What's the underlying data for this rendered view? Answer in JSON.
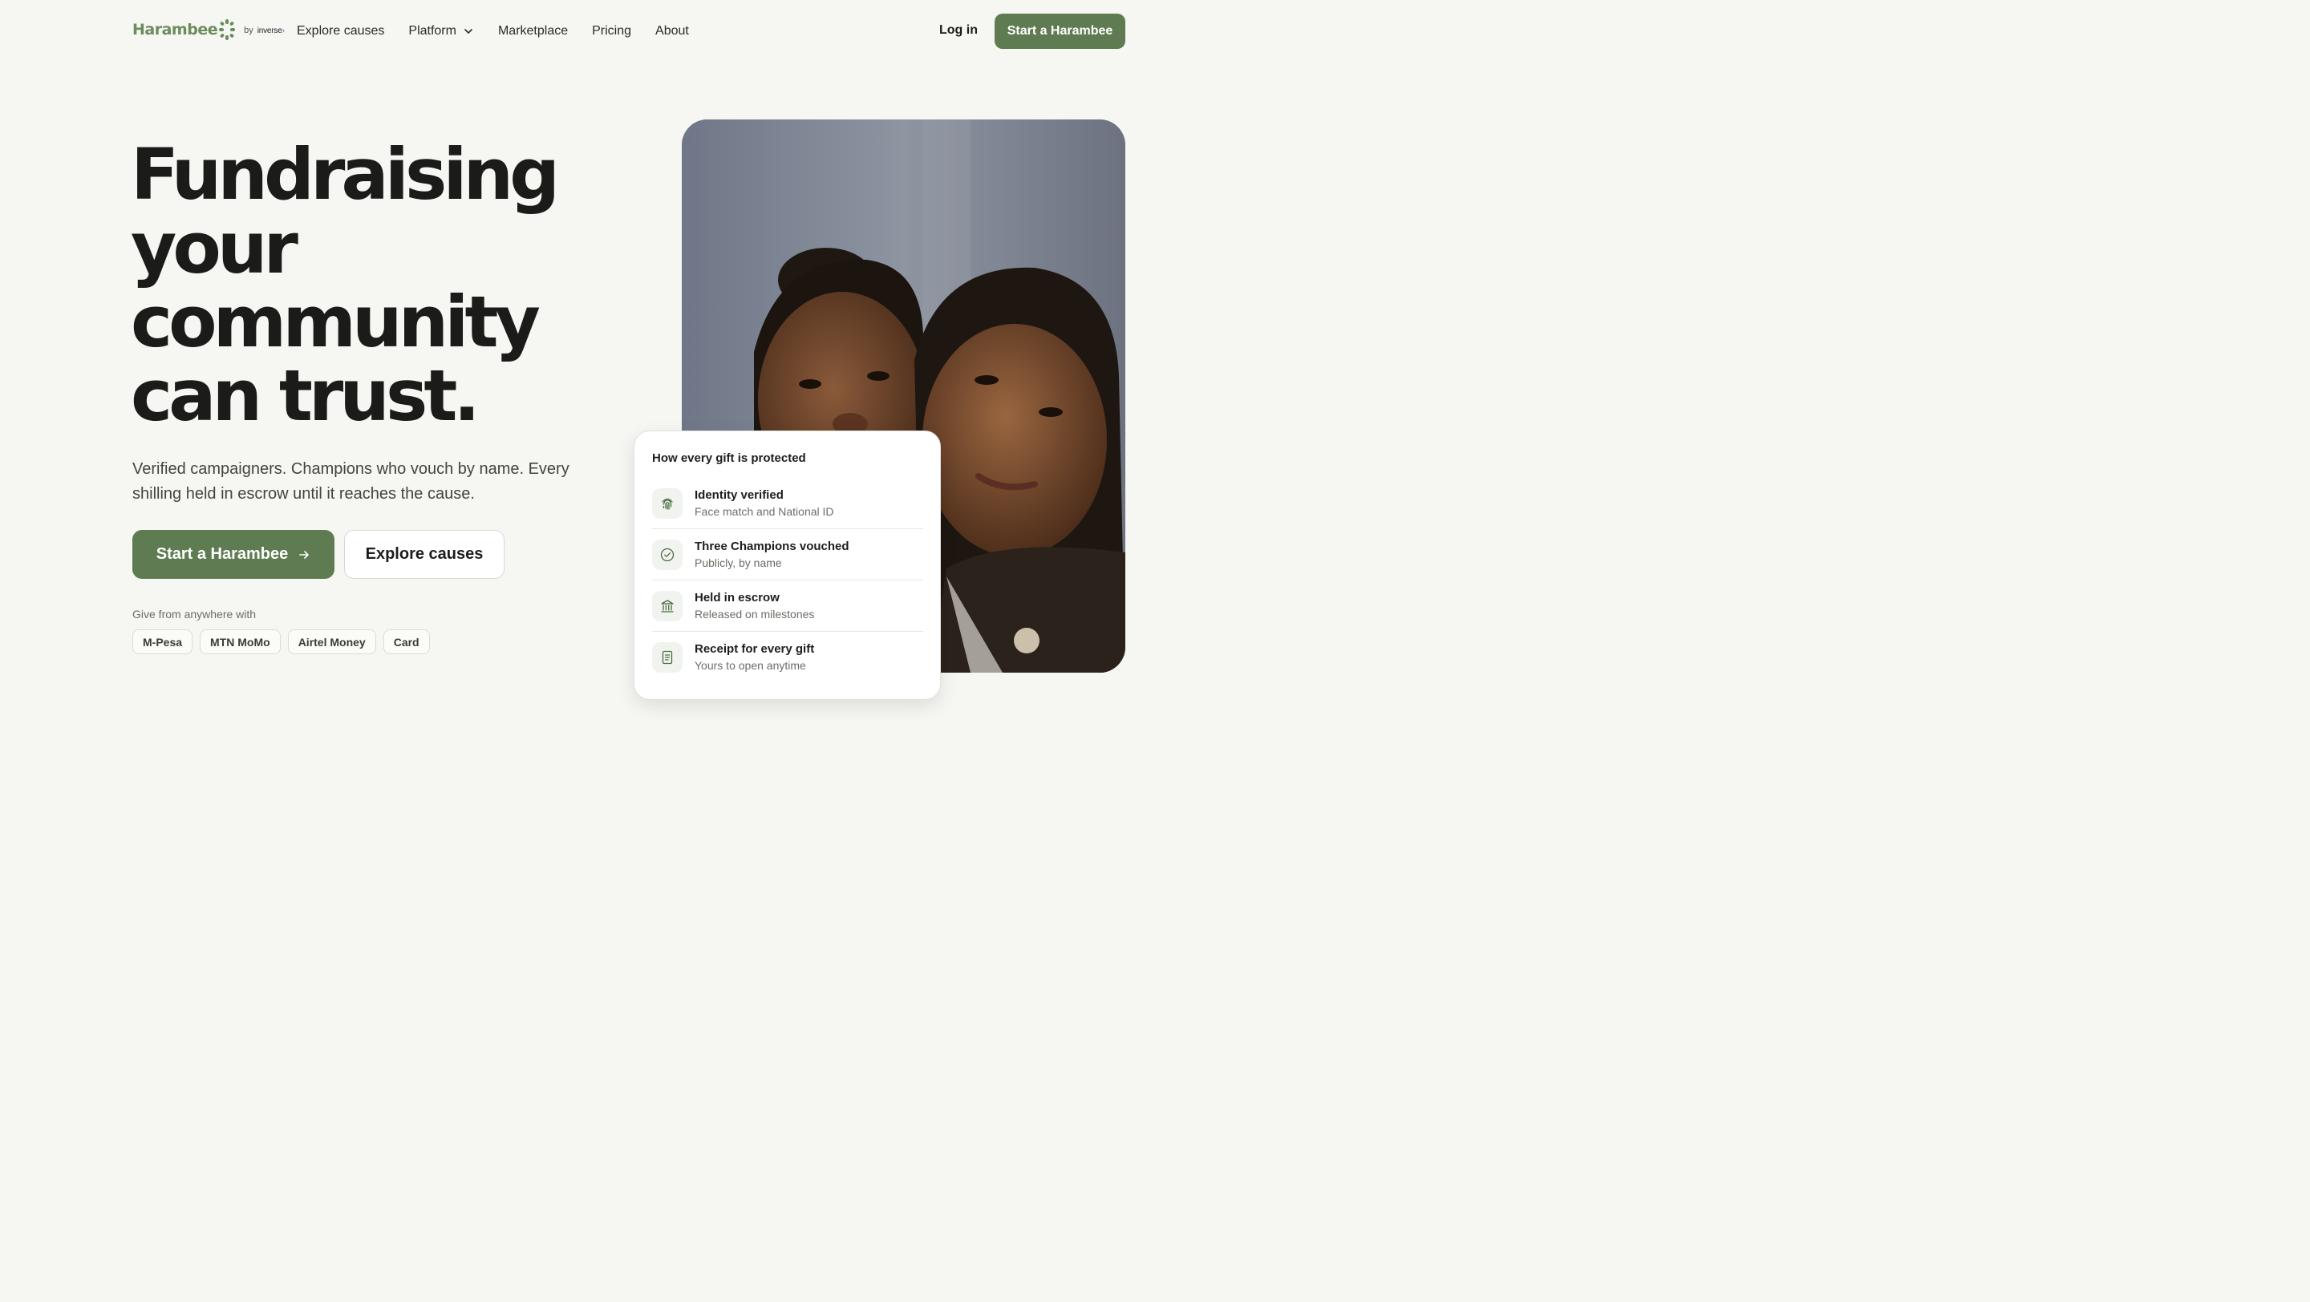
{
  "brand": {
    "name": "Harambee",
    "by": "by",
    "partner": "inverse"
  },
  "nav": {
    "links": [
      "Explore causes",
      "Platform",
      "Marketplace",
      "Pricing",
      "About"
    ],
    "login": "Log in",
    "cta": "Start a Harambee"
  },
  "hero": {
    "headline_lines": [
      "Fundraising",
      "your",
      "community",
      "can trust."
    ],
    "subtitle": "Verified campaigners. Champions who vouch by name. Every shilling held in escrow until it reaches the cause.",
    "primary_cta": "Start a Harambee",
    "secondary_cta": "Explore causes",
    "give_label": "Give from anywhere with",
    "payment_methods": [
      "M-Pesa",
      "MTN MoMo",
      "Airtel Money",
      "Card"
    ]
  },
  "protection_card": {
    "title": "How every gift is protected",
    "items": [
      {
        "title": "Identity verified",
        "subtitle": "Face match and National ID",
        "icon": "fingerprint-icon"
      },
      {
        "title": "Three Champions vouched",
        "subtitle": "Publicly, by name",
        "icon": "check-badge-icon"
      },
      {
        "title": "Held in escrow",
        "subtitle": "Released on milestones",
        "icon": "bank-icon"
      },
      {
        "title": "Receipt for every gift",
        "subtitle": "Yours to open anytime",
        "icon": "receipt-icon"
      }
    ]
  },
  "colors": {
    "brand_green": "#5f7b52",
    "logo_green": "#6b8c5b",
    "background": "#f6f6f2"
  }
}
